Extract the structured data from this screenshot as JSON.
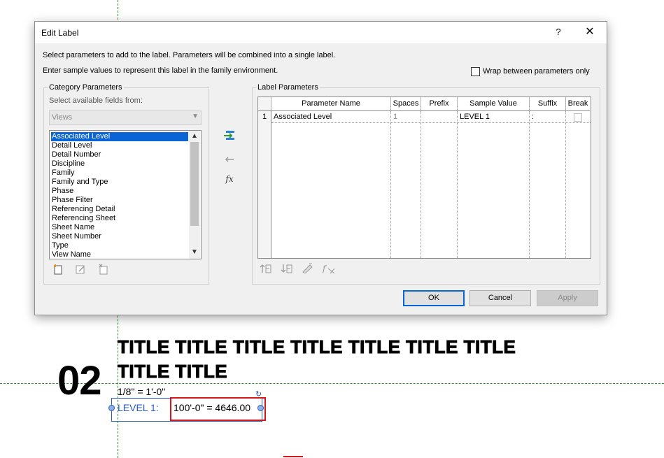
{
  "dialog": {
    "title": "Edit Label",
    "help_label": "?",
    "close_label": "✕",
    "description_1": "Select parameters to add to the label.  Parameters will be combined into a single label.",
    "description_2": "Enter sample values to represent this label in the family environment.",
    "wrap_checkbox_label": "Wrap between parameters only",
    "wrap_checked": false
  },
  "category": {
    "group_title": "Category Parameters",
    "fields_label": "Select available fields from:",
    "source_value": "Views",
    "items": [
      "Associated Level",
      "Detail Level",
      "Detail Number",
      "Discipline",
      "Family",
      "Family and Type",
      "Phase",
      "Phase Filter",
      "Referencing Detail",
      "Referencing Sheet",
      "Sheet Name",
      "Sheet Number",
      "Type",
      "View Name"
    ],
    "selected_item": "Associated Level",
    "tool_icons": [
      "new-parameter-icon",
      "edit-parameter-icon",
      "delete-parameter-icon"
    ]
  },
  "transfer": {
    "icons": [
      "add-parameter-icon",
      "remove-parameter-icon",
      "formula-icon"
    ],
    "formula_glyph": "fx"
  },
  "label_params": {
    "group_title": "Label Parameters",
    "columns": [
      "Parameter Name",
      "Spaces",
      "Prefix",
      "Sample Value",
      "Suffix",
      "Break"
    ],
    "rows": [
      {
        "index": "1",
        "parameter_name": "Associated Level",
        "spaces": "1",
        "prefix": "",
        "sample_value": "LEVEL 1",
        "suffix": ":",
        "break": false
      }
    ],
    "tool_icons": [
      "move-up-icon",
      "move-down-icon",
      "edit-format-icon",
      "formula-edit-icon"
    ]
  },
  "buttons": {
    "ok": "OK",
    "cancel": "Cancel",
    "apply": "Apply"
  },
  "canvas": {
    "view_number": "02",
    "title_line_1": "TITLE TITLE TITLE TITLE TITLE TITLE TITLE",
    "title_line_2": "TITLE TITLE",
    "scale": "1/8\" = 1'-0\"",
    "level_label": "LEVEL 1:",
    "level_value": "100'-0\" = 4646.00"
  },
  "colors": {
    "selection_blue": "#0a64d6",
    "guide_green": "#2e8b2e",
    "label_blue": "#2a59c9",
    "highlight_red": "#d4161f"
  }
}
